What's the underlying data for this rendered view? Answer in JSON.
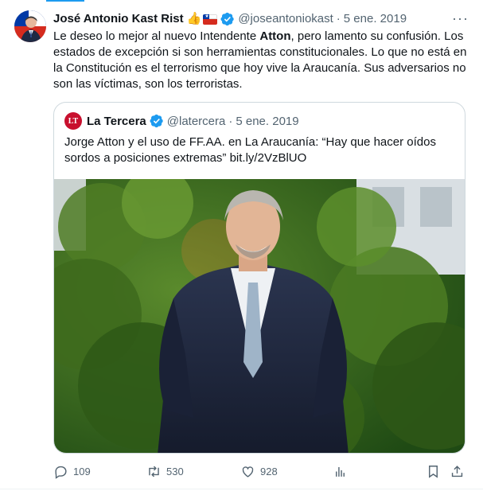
{
  "tweet": {
    "author_name": "José Antonio Kast Rist",
    "author_emojis": "👍",
    "handle": "@joseantoniokast",
    "separator": "·",
    "date": "5 ene. 2019",
    "more": "···",
    "text_part1": "Le deseo lo mejor al nuevo Intendente ",
    "text_bold": "Atton",
    "text_part2": ", pero lamento su confusión. Los estados de excepción si son herramientas constitucionales. Lo que no está en la Constitución es el terrorismo que hoy vive la Araucanía. Sus adversarios no son las víctimas, son los terroristas."
  },
  "quote": {
    "logo_text": "LT",
    "author_name": "La Tercera",
    "handle": "@latercera",
    "separator": "·",
    "date": "5 ene. 2019",
    "text": "Jorge Atton y el uso de FF.AA. en La Araucanía: “Hay que hacer oídos sordos a posiciones extremas” bit.ly/2VzBlUO"
  },
  "actions": {
    "replies": "109",
    "reposts": "530",
    "likes": "928"
  },
  "colors": {
    "accent": "#1d9bf0",
    "secondary_text": "#536471",
    "border": "#cfd9de",
    "la_tercera_red": "#c8102e"
  }
}
